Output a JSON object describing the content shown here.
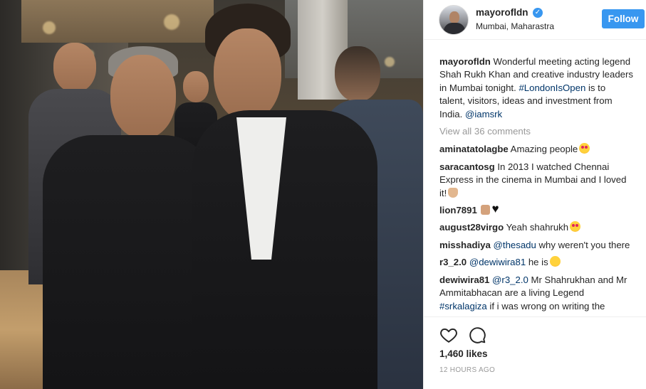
{
  "post": {
    "photo_subject": "Sadiq Khan and Shah Rukh Khan"
  },
  "header": {
    "username": "mayorofldn",
    "verified_icon": "verified-badge-icon",
    "location": "Mumbai, Maharastra",
    "follow_label": "Follow"
  },
  "caption": {
    "username": "mayorofldn",
    "text_1": "Wonderful meeting acting legend Shah Rukh Khan and creative industry leaders in Mumbai tonight.",
    "hashtag": "#LondonIsOpen",
    "text_2": "is to talent, visitors, ideas and investment from India.",
    "mention": "@iamsrk"
  },
  "view_all_comments": "View all 36 comments",
  "comments": [
    {
      "user": "aminatatolagbe",
      "text": "Amazing people",
      "emoji": "heart-eyes-emoji"
    },
    {
      "user": "saracantosg",
      "text": "In 2013 I watched Chennai Express in the cinema in Mumbai and I loved it!",
      "emoji": "clapping-hand-emoji"
    },
    {
      "user": "lion7891",
      "text": "",
      "emoji": "thumbs-up-black-heart-emoji"
    },
    {
      "user": "august28virgo",
      "text": "Yeah shahrukh",
      "emoji": "heart-eyes-emoji"
    },
    {
      "user": "misshadiya",
      "mention": "@thesadu",
      "text": "why weren't you there"
    },
    {
      "user": "r3_2.0",
      "mention": "@dewiwira81",
      "text": "he is",
      "emoji": "smiling-emoji"
    },
    {
      "user": "dewiwira81",
      "mention": "@r3_2.0",
      "text": "Mr Shahrukhan and Mr Ammitabhacan are a living Legend",
      "mention_2": "#srkalagiza",
      "text_2": "if i was wrong on writing the"
    }
  ],
  "actions": {
    "like_icon": "heart-outline-icon",
    "comment_icon": "comment-bubble-icon"
  },
  "likes": "1,460 likes",
  "timestamp": "12 HOURS AGO",
  "colors": {
    "accent": "#3897f0",
    "link": "#003569",
    "muted": "#999999",
    "text": "#262626"
  }
}
